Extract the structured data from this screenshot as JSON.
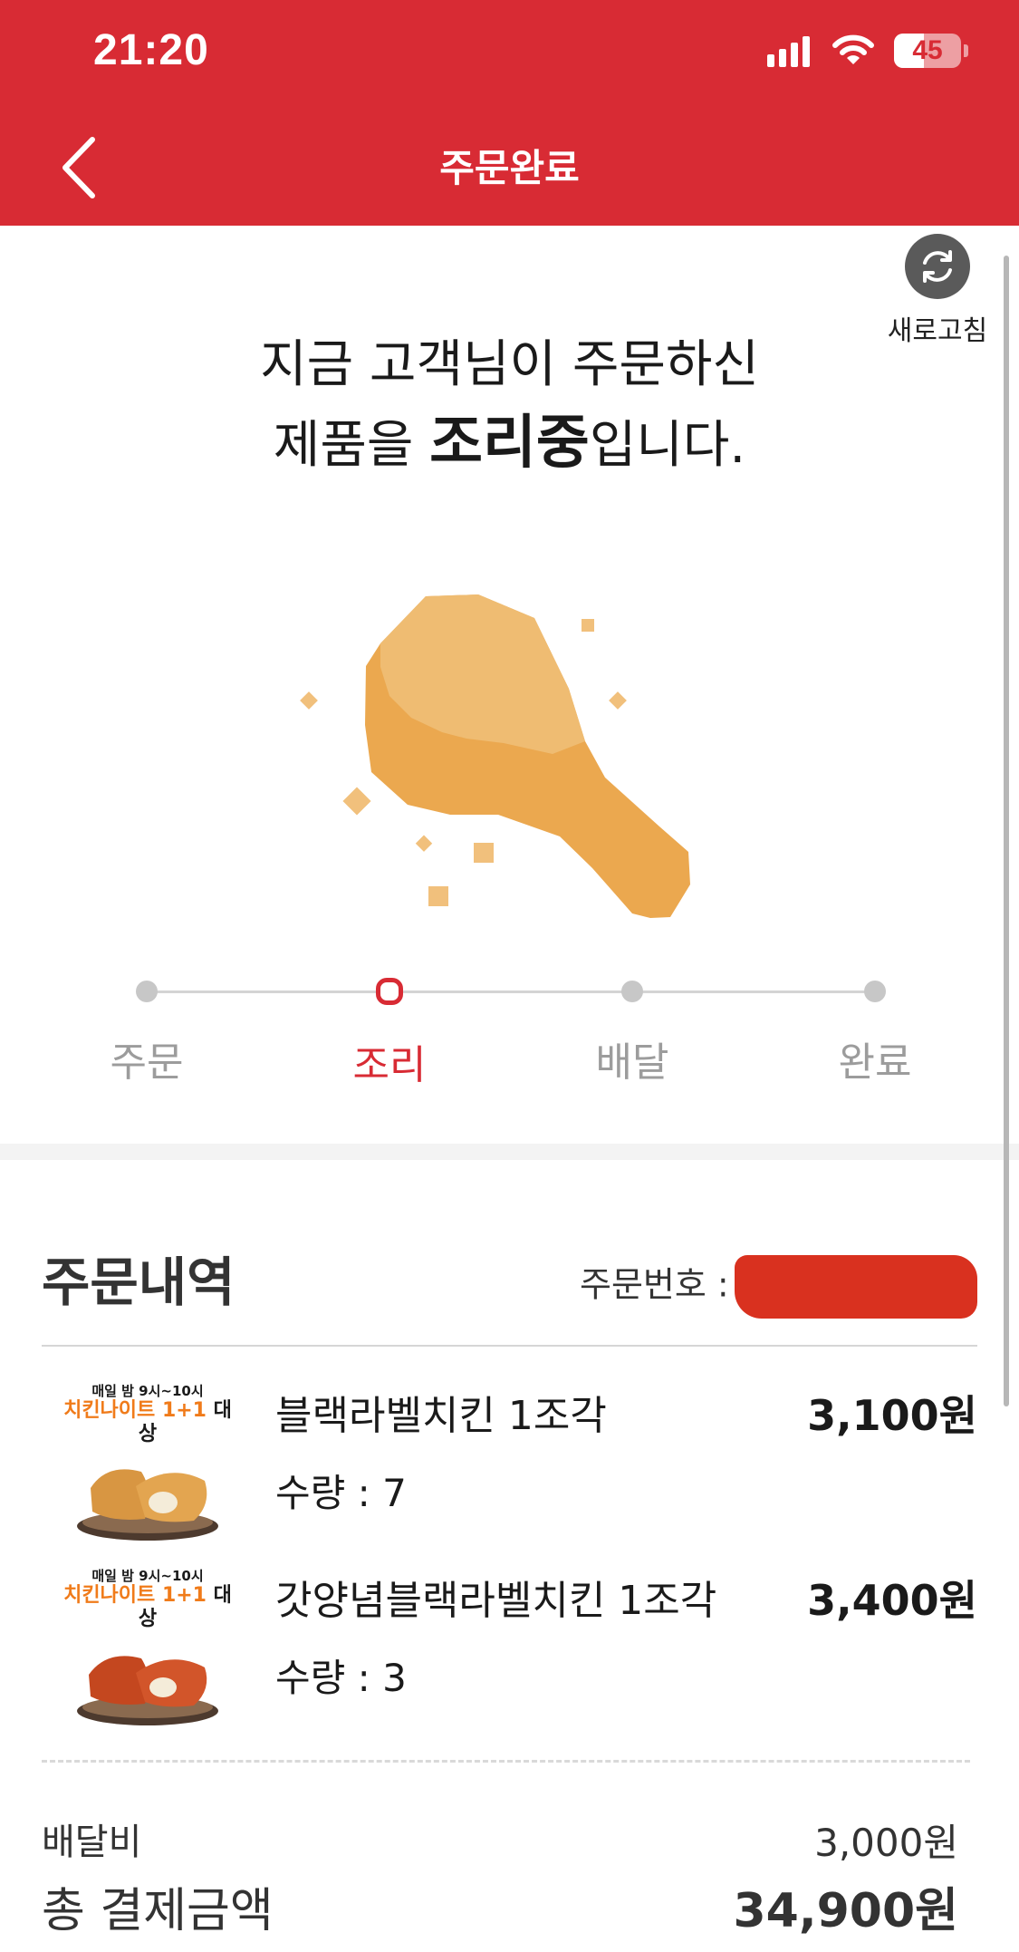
{
  "status_bar": {
    "time": "21:20",
    "battery": "45",
    "battery_level": 0.45,
    "signal_icon": "cellular-signal-icon",
    "wifi_icon": "wifi-icon"
  },
  "header": {
    "title": "주문완료",
    "back_icon": "chevron-left-icon",
    "color": "#d82b34"
  },
  "refresh": {
    "label": "새로고침",
    "icon": "refresh-icon"
  },
  "headline": {
    "line1": "지금 고객님이 주문하신",
    "line2_prefix": "제품을 ",
    "line2_emphasis": "조리중",
    "line2_suffix": "입니다."
  },
  "illustration": {
    "icon": "chicken-drumstick-icon"
  },
  "progress": {
    "steps": [
      {
        "label": "주문",
        "active": false
      },
      {
        "label": "조리",
        "active": true
      },
      {
        "label": "배달",
        "active": false
      },
      {
        "label": "완료",
        "active": false
      }
    ],
    "active_color": "#d82b34"
  },
  "order": {
    "section_title": "주문내역",
    "order_number_label": "주문번호 :",
    "items": [
      {
        "thumb_top": "매일 밤 9시~10시",
        "thumb_promo": "치킨나이트 1+1",
        "thumb_promo_suffix": "대상",
        "name": "블랙라벨치킨 1조각",
        "quantity": "수량 : 7",
        "price": "3,100원"
      },
      {
        "thumb_top": "매일 밤 9시~10시",
        "thumb_promo": "치킨나이트 1+1",
        "thumb_promo_suffix": "대상",
        "name": "갓양념블랙라벨치킨 1조각",
        "quantity": "수량 : 3",
        "price": "3,400원"
      }
    ]
  },
  "summary": {
    "delivery_fee_label": "배달비",
    "delivery_fee": "3,000원",
    "total_label": "총 결제금액",
    "total": "34,900원"
  }
}
